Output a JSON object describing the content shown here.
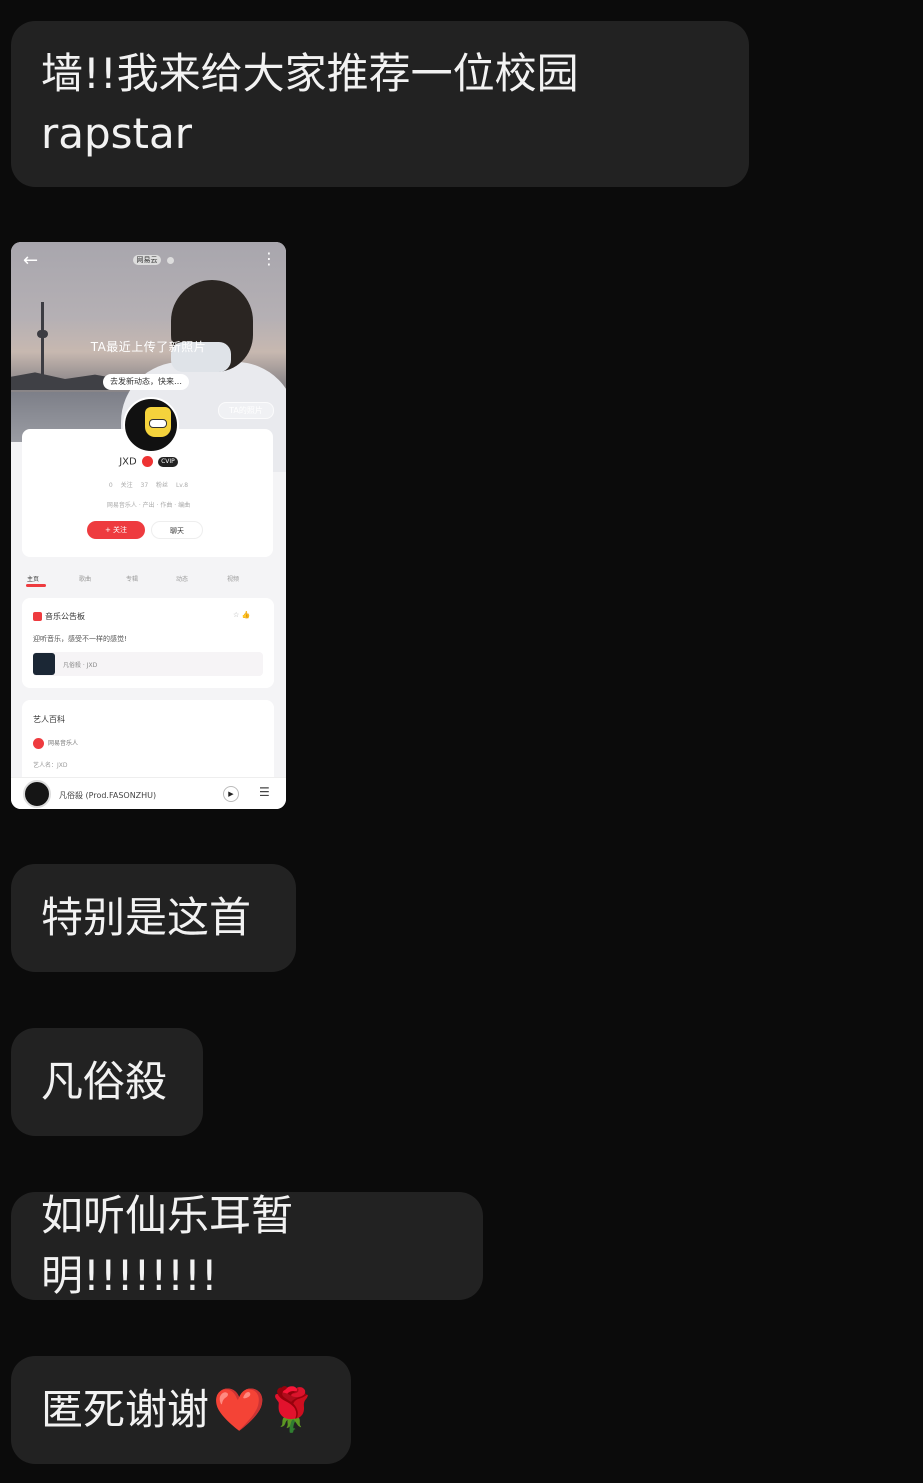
{
  "messages": [
    {
      "text": "墙!!我来给大家推荐一位校园rapstar"
    },
    {
      "text": "特别是这首"
    },
    {
      "text": "凡俗殺"
    },
    {
      "text": "如听仙乐耳暂明!!!!!!!!"
    },
    {
      "text": "匿死谢谢",
      "emojis": "❤️🌹"
    }
  ],
  "screenshot": {
    "back_icon": "←",
    "more_icon": "⋮",
    "pill_label": "网易云",
    "cover_text": "TA最近上传了新照片",
    "cover_button": "去发新动态，快来…",
    "photos_button": "TA的照片",
    "artist_name": "JXD",
    "badge": "CVIP",
    "stats": "0 关注   37 粉丝   Lv.8",
    "bio": "网易音乐人 · 产出 · 作曲 · 编曲",
    "follow_button": "+ 关注",
    "chat_button": "聊天",
    "tabs": [
      "主页",
      "歌曲",
      "专辑",
      "动态",
      "视频"
    ],
    "board_title": "音乐公告板",
    "board_icons": "☆ 👍",
    "board_text": "迎听音乐，感受不一样的感觉!",
    "board_track": "凡俗殺 · JXD",
    "wiki_title": "艺人百科",
    "wiki_item": "网易音乐人",
    "wiki_sub": "艺人名：JXD",
    "player_title": "凡俗殺 (Prod.FASONZHU)",
    "player_play": "▶",
    "player_list": "☰"
  }
}
